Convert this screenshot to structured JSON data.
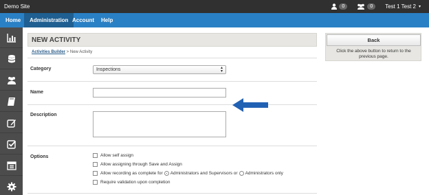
{
  "topbar": {
    "site_title": "Demo Site",
    "user_count": "0",
    "group_count": "0",
    "user_name": "Test 1 Test 2",
    "caret": "▾"
  },
  "nav": {
    "items": [
      {
        "label": "Home"
      },
      {
        "label": "Administration"
      },
      {
        "label": "Account"
      },
      {
        "label": "Help"
      }
    ],
    "active": "Administration"
  },
  "sidebar": {
    "icons": [
      "bar-chart-icon",
      "database-icon",
      "users-icon",
      "book-icon",
      "edit-icon",
      "check-square-icon",
      "calendar-icon",
      "gear-icon"
    ]
  },
  "main": {
    "title": "NEW ACTIVITY",
    "breadcrumb": {
      "link": "Activities Builder",
      "separator": " > ",
      "current": "New Activity"
    },
    "category": {
      "label": "Category",
      "value": "Inspections",
      "arrow": "▴▾"
    },
    "name": {
      "label": "Name",
      "value": ""
    },
    "description": {
      "label": "Description",
      "value": ""
    },
    "options": {
      "label": "Options",
      "items": [
        "Allow self assign",
        "Allow assigning through Save and Assign",
        "Allow recording as complete for",
        "Require validation upon completion"
      ],
      "radio_a": "Administrators and Supervisors or",
      "radio_b": "Administrators only"
    }
  },
  "right": {
    "back_label": "Back",
    "back_help": "Click the above button to return to the previous page."
  },
  "colors": {
    "nav": "#2a80c4",
    "nav_active": "#1f5f91",
    "topbar": "#303030",
    "sidebar": "#4c4c4c",
    "annotation_arrow": "#2161b4"
  }
}
